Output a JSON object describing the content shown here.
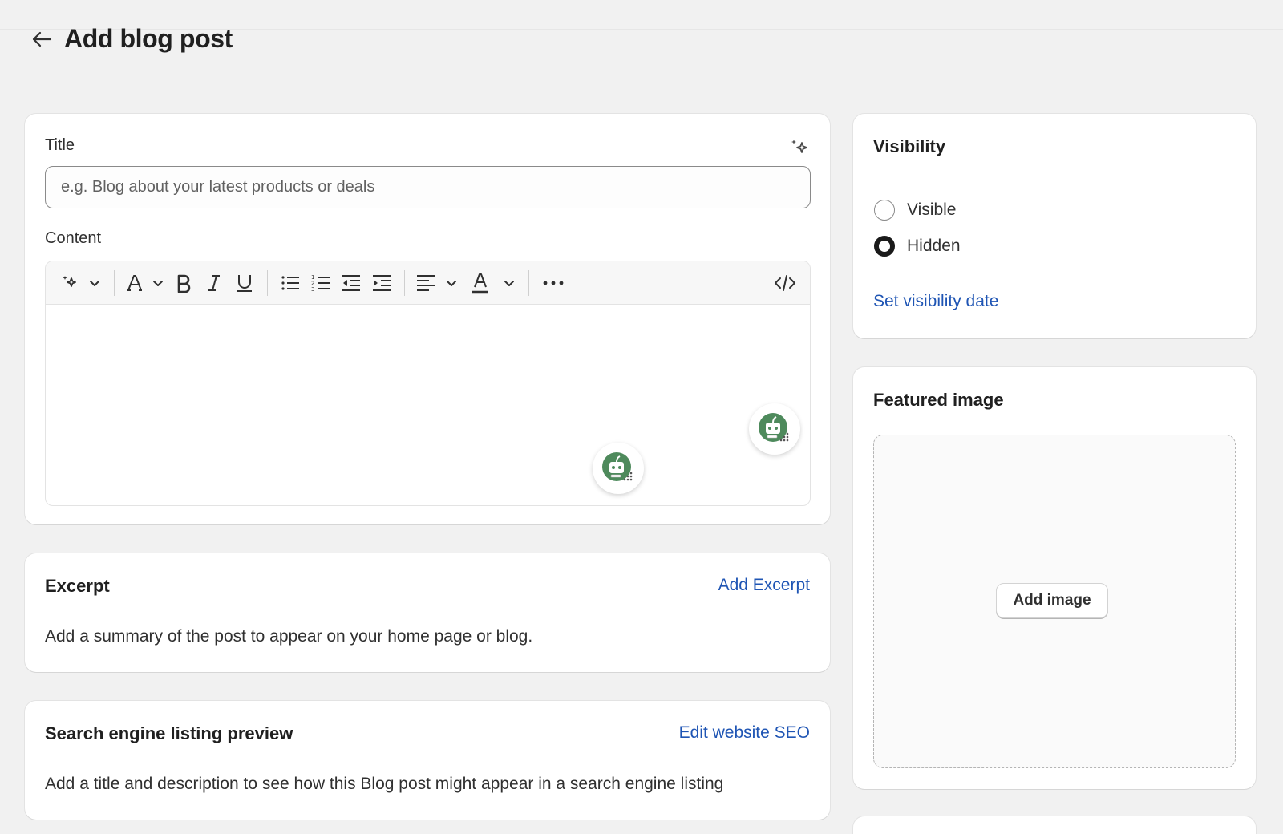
{
  "header": {
    "title": "Add blog post"
  },
  "main": {
    "title_label": "Title",
    "title_placeholder": "e.g. Blog about your latest products or deals",
    "content_label": "Content"
  },
  "excerpt": {
    "title": "Excerpt",
    "action": "Add Excerpt",
    "description": "Add a summary of the post to appear on your home page or blog."
  },
  "seo": {
    "title": "Search engine listing preview",
    "action": "Edit website SEO",
    "description": "Add a title and description to see how this Blog post might appear in a search engine listing"
  },
  "visibility": {
    "title": "Visibility",
    "options": [
      {
        "label": "Visible",
        "checked": false
      },
      {
        "label": "Hidden",
        "checked": true
      }
    ],
    "set_date_link": "Set visibility date"
  },
  "featured_image": {
    "title": "Featured image",
    "button": "Add image"
  },
  "colors": {
    "background": "#f1f1f1",
    "link": "#1f55b4",
    "bot_green": "#4e8a5c"
  }
}
